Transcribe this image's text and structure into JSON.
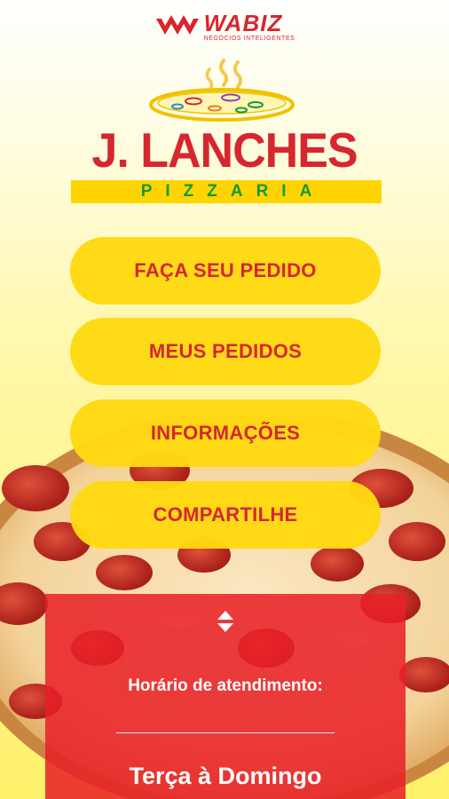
{
  "brand": {
    "name": "WABIZ",
    "tagline": "NEGÓCIOS INTELIGENTES"
  },
  "logo": {
    "title": "J. LANCHES",
    "subtitle": "PIZZARIA"
  },
  "menu": [
    {
      "label": "FAÇA SEU PEDIDO"
    },
    {
      "label": "MEUS PEDIDOS"
    },
    {
      "label": "INFORMAÇÕES"
    },
    {
      "label": "COMPARTILHE"
    }
  ],
  "hours": {
    "label": "Horário de atendimento:",
    "days": "Terça à Domingo",
    "toggle_icon": "up-down-arrows-icon"
  },
  "colors": {
    "red": "#d6262e",
    "yellow": "#ffd912",
    "green": "#149a3a"
  }
}
